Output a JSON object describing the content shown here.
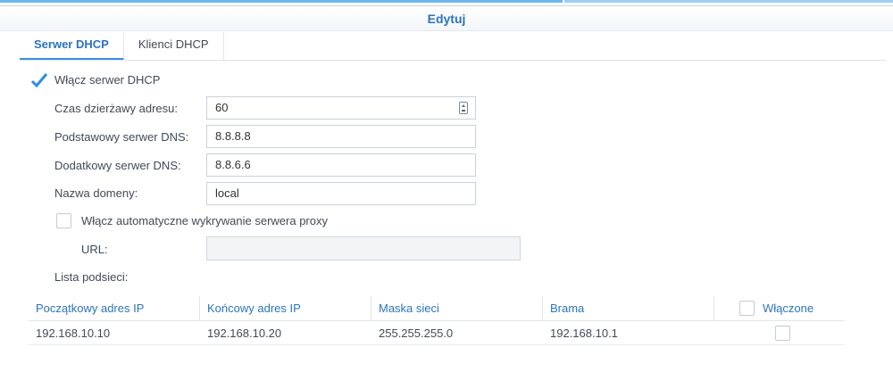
{
  "window": {
    "title": "Edytuj"
  },
  "tabs": [
    {
      "label": "Serwer DHCP",
      "active": true
    },
    {
      "label": "Klienci DHCP",
      "active": false
    }
  ],
  "dhcp": {
    "enable_label": "Włącz serwer DHCP",
    "enable_checked": true,
    "lease_label": "Czas dzierżawy adresu:",
    "lease_value": "60",
    "dns1_label": "Podstawowy serwer DNS:",
    "dns1_value": "8.8.8.8",
    "dns2_label": "Dodatkowy serwer DNS:",
    "dns2_value": "8.8.6.6",
    "domain_label": "Nazwa domeny:",
    "domain_value": "local",
    "proxy_label": "Włącz automatyczne wykrywanie serwera proxy",
    "proxy_checked": false,
    "url_label": "URL:",
    "url_value": "",
    "subnet_list_label": "Lista podsieci:"
  },
  "subnets": {
    "columns": [
      "Początkowy adres IP",
      "Końcowy adres IP",
      "Maska sieci",
      "Brama",
      "Włączone"
    ],
    "rows": [
      {
        "start": "192.168.10.10",
        "end": "192.168.10.20",
        "mask": "255.255.255.0",
        "gateway": "192.168.10.1",
        "enabled": false
      }
    ]
  },
  "colors": {
    "accent": "#2a74c0",
    "check": "#2f8de4"
  }
}
